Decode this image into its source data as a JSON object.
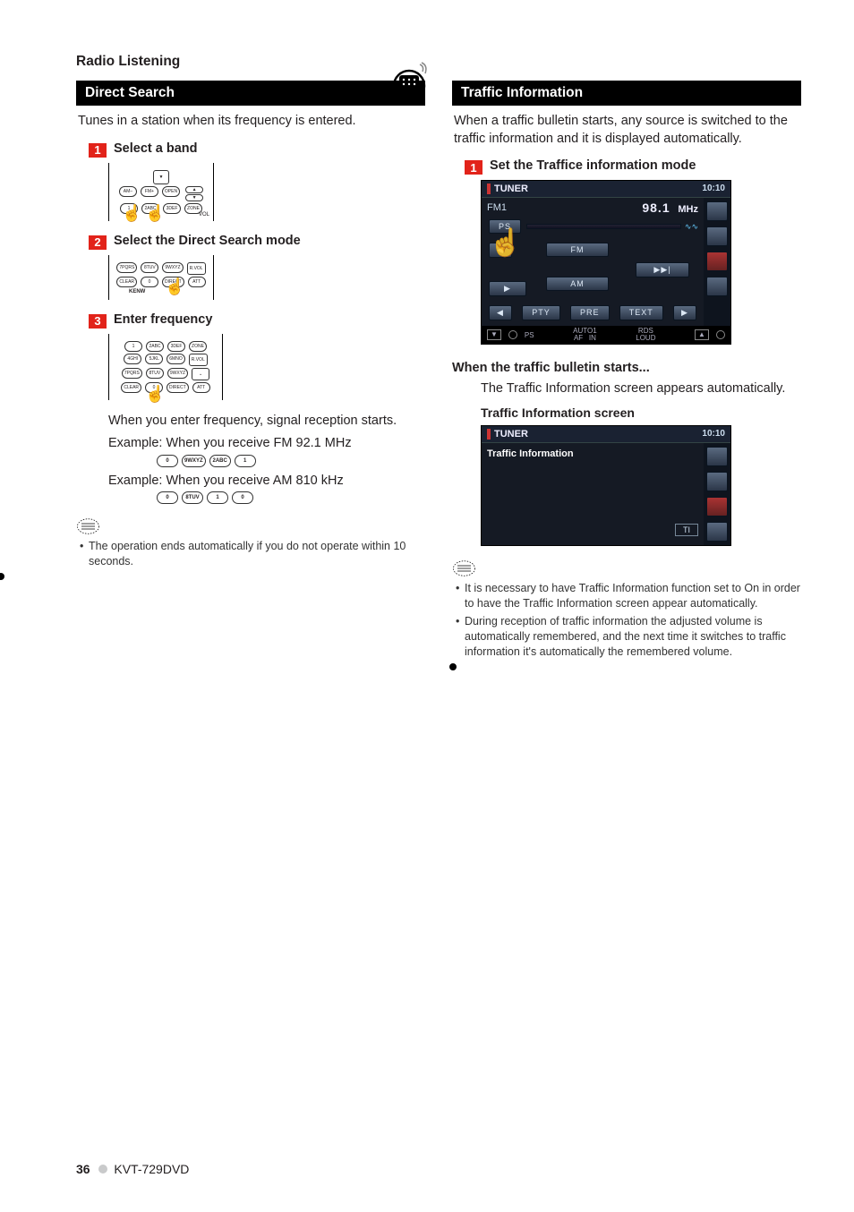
{
  "page": {
    "section_title": "Radio Listening",
    "number": "36",
    "product": "KVT-729DVD"
  },
  "left": {
    "bar_title": "Direct Search",
    "intro": "Tunes in a station when its frequency is entered.",
    "step1": {
      "num": "1",
      "title": "Select a band"
    },
    "step2": {
      "num": "2",
      "title": "Select the Direct Search mode"
    },
    "step3": {
      "num": "3",
      "title": "Enter frequency"
    },
    "remote_labels": {
      "am": "AM–",
      "fm": "FM+",
      "open": "OPEN",
      "vol": "VOL",
      "k1": "1",
      "k2": "2ABC",
      "k3": "3DEF",
      "zone": "ZONE",
      "k4": "4GHI",
      "k5": "5JKL",
      "k6": "6MNO",
      "rvol": "R.VOL",
      "k7": "7PQRS",
      "k8": "8TUV",
      "k9": "9WXYZ",
      "clear": "CLEAR",
      "k0": "0",
      "direct": "DIRECT",
      "att": "ATT",
      "kenw": "KENW"
    },
    "after_freq_text": "When you enter frequency, signal reception starts.",
    "ex1_label": "Example: When you receive FM 92.1 MHz",
    "ex1_keys": [
      "0",
      "9WXYZ",
      "2ABC",
      "1"
    ],
    "ex2_label": "Example: When you receive AM 810 kHz",
    "ex2_keys": [
      "0",
      "8TUV",
      "1",
      "0"
    ],
    "notes": [
      "The operation ends automatically if you do not operate within 10 seconds."
    ]
  },
  "right": {
    "bar_title": "Traffic Information",
    "intro": "When a traffic bulletin starts, any source is switched to the traffic information and it is displayed automatically.",
    "step1": {
      "num": "1",
      "title": "Set the Traffice information mode"
    },
    "screen1": {
      "title": "TUNER",
      "clock": "10:10",
      "band": "FM1",
      "freq": "98.1",
      "unit": "MHz",
      "ps_btn": "PS",
      "fm_btn": "FM",
      "am_btn": "AM",
      "seek_btn": "▶▶|",
      "pty": "PTY",
      "pre": "PRE",
      "text": "TEXT",
      "status": {
        "ps": "PS",
        "auto": "AUTO1",
        "af": "AF",
        "in": "IN",
        "rds": "RDS",
        "loud": "LOUD"
      }
    },
    "when_heading": "When the traffic bulletin starts...",
    "when_text": "The Traffic Information screen appears automatically.",
    "screen2_heading": "Traffic Information screen",
    "screen2": {
      "title": "TUNER",
      "clock": "10:10",
      "body_title": "Traffic Information",
      "ti": "TI"
    },
    "notes": [
      "It is necessary to have Traffic Information function set to On in order to have the Traffic Information screen appear automatically.",
      "During reception of traffic information the adjusted volume is automatically remembered, and the next time it switches to traffic information it's automatically the remembered volume."
    ]
  }
}
